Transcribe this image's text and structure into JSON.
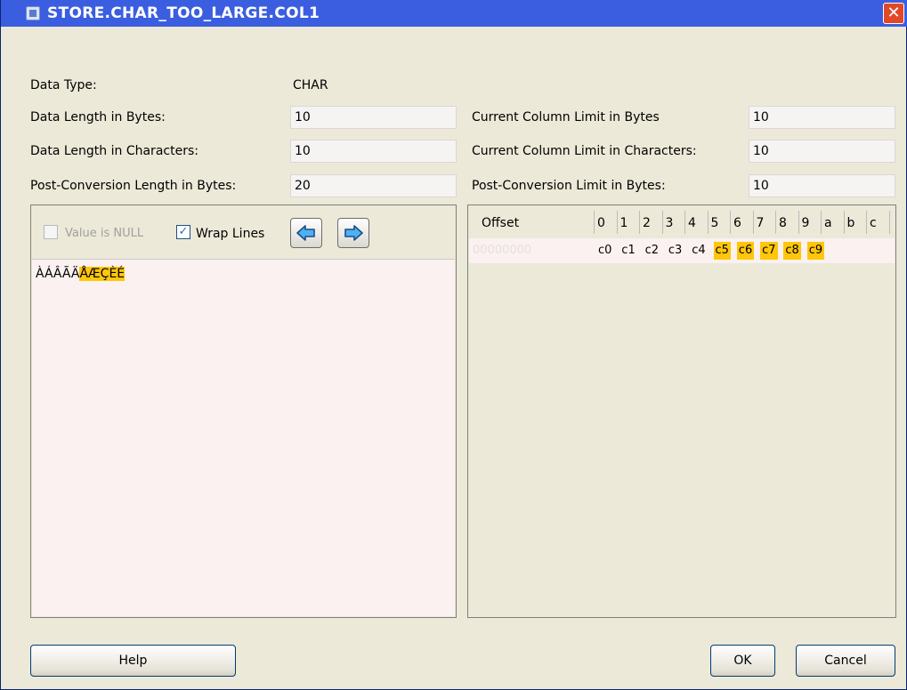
{
  "window": {
    "title": "STORE.CHAR_TOO_LARGE.COL1",
    "close_label": "✕"
  },
  "fields": {
    "data_type_label": "Data Type:",
    "data_type_value": "CHAR",
    "data_len_bytes_label": "Data Length in Bytes:",
    "data_len_bytes_value": "10",
    "data_len_chars_label": "Data Length in Characters:",
    "data_len_chars_value": "10",
    "post_conv_len_bytes_label": "Post-Conversion Length in Bytes:",
    "post_conv_len_bytes_value": "20",
    "cur_col_limit_bytes_label": "Current Column Limit in Bytes",
    "cur_col_limit_bytes_value": "10",
    "cur_col_limit_chars_label": "Current Column Limit in Characters:",
    "cur_col_limit_chars_value": "10",
    "post_conv_limit_bytes_label": "Post-Conversion Limit in Bytes:",
    "post_conv_limit_bytes_value": "10"
  },
  "editor": {
    "value_is_null_label": "Value is NULL",
    "value_is_null_checked": false,
    "wrap_lines_label": "Wrap Lines",
    "wrap_lines_checked": true,
    "text_normal": "ÀÁÂÃÄ",
    "text_highlight": "ÅÆÇÈÉ"
  },
  "hex": {
    "offset_header": "Offset",
    "columns": [
      "0",
      "1",
      "2",
      "3",
      "4",
      "5",
      "6",
      "7",
      "8",
      "9",
      "a",
      "b",
      "c"
    ],
    "row_offset": "00000000",
    "bytes": [
      {
        "v": "c0",
        "hl": false
      },
      {
        "v": "c1",
        "hl": false
      },
      {
        "v": "c2",
        "hl": false
      },
      {
        "v": "c3",
        "hl": false
      },
      {
        "v": "c4",
        "hl": false
      },
      {
        "v": "c5",
        "hl": true
      },
      {
        "v": "c6",
        "hl": true
      },
      {
        "v": "c7",
        "hl": true
      },
      {
        "v": "c8",
        "hl": true
      },
      {
        "v": "c9",
        "hl": true
      }
    ]
  },
  "buttons": {
    "help": "Help",
    "ok": "OK",
    "cancel": "Cancel"
  },
  "colors": {
    "titlebar": "#3b5ee0",
    "highlight": "#ffc60a",
    "dialog_bg": "#ece9d8"
  }
}
